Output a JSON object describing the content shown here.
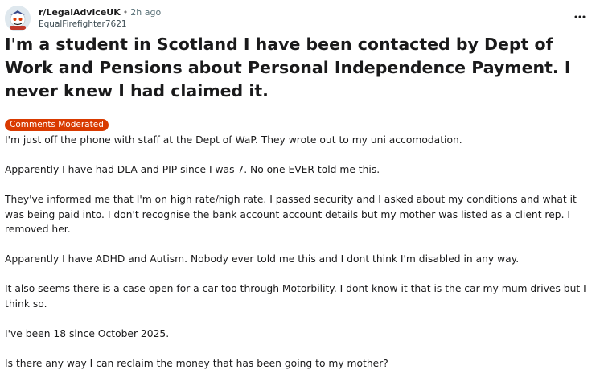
{
  "post": {
    "subreddit": "r/LegalAdviceUK",
    "separator": "•",
    "time": "2h ago",
    "author": "EqualFirefighter7621",
    "more_icon": "more-horizontal-icon",
    "title": "I'm a student in Scotland I have been contacted by Dept of Work and Pensions about Personal Independence Payment. I never knew I had claimed it.",
    "flair": {
      "label": "Comments Moderated",
      "color": "#d93a00"
    },
    "paragraphs": [
      "I'm just off the phone with staff at the Dept of WaP. They wrote out to my uni accomodation.",
      "Apparently I have had DLA and PIP since I was 7. No one EVER told me this.",
      "They've informed me that I'm on high rate/high rate. I passed security and I asked about my conditions and what it was being paid into. I don't recognise the bank account account details but my mother was listed as a client rep. I removed her.",
      "Apparently I have ADHD and Autism. Nobody ever told me this and I dont think I'm disabled in any way.",
      "It also seems there is a case open for a car too through Motorbility. I dont know it that is the car my mum drives but I think so.",
      "I've been 18 since October 2025.",
      "Is there any way I can reclaim the money that has been going to my mother?"
    ]
  }
}
